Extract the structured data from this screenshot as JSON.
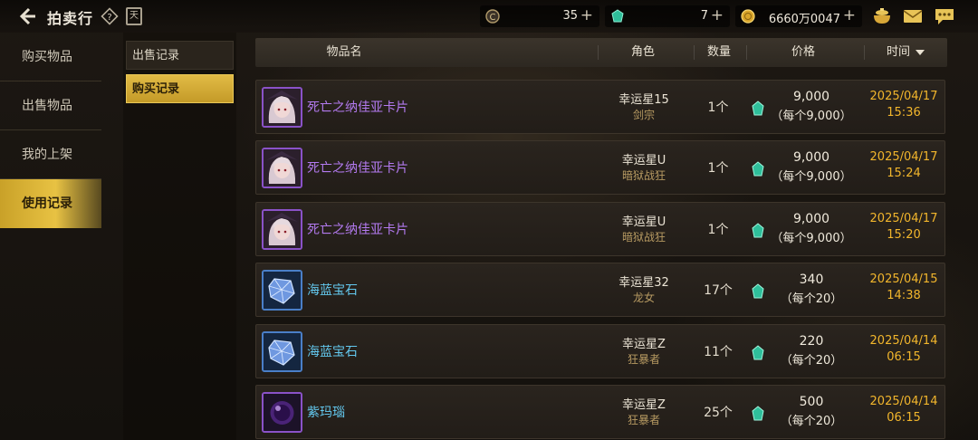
{
  "header": {
    "title": "拍卖行",
    "calendar_label": "天",
    "currencies": [
      {
        "icon": "c-coin-icon",
        "value": "35"
      },
      {
        "icon": "green-gem-icon",
        "value": "7"
      },
      {
        "icon": "gold-coin-icon",
        "value": "6660万0047"
      }
    ],
    "plus": "+"
  },
  "nav": {
    "items": [
      {
        "label": "购买物品",
        "active": false
      },
      {
        "label": "出售物品",
        "active": false
      },
      {
        "label": "我的上架",
        "active": false
      },
      {
        "label": "使用记录",
        "active": true
      }
    ]
  },
  "subnav": {
    "items": [
      {
        "label": "出售记录",
        "active": false
      },
      {
        "label": "购买记录",
        "active": true
      }
    ]
  },
  "table": {
    "columns": {
      "item": "物品名",
      "role": "角色",
      "qty": "数量",
      "price": "价格",
      "time": "时间"
    },
    "rows": [
      {
        "icon": "girl-card-icon",
        "name": "死亡之纳佳亚卡片",
        "rarity": "purple",
        "character": "幸运星15",
        "class": "剑宗",
        "qty": "1个",
        "price": "9,000",
        "each": "（每个9,000）",
        "date": "2025/04/17",
        "time": "15:36"
      },
      {
        "icon": "girl-card-icon",
        "name": "死亡之纳佳亚卡片",
        "rarity": "purple",
        "character": "幸运星U",
        "class": "暗狱战狂",
        "qty": "1个",
        "price": "9,000",
        "each": "（每个9,000）",
        "date": "2025/04/17",
        "time": "15:24"
      },
      {
        "icon": "girl-card-icon",
        "name": "死亡之纳佳亚卡片",
        "rarity": "purple",
        "character": "幸运星U",
        "class": "暗狱战狂",
        "qty": "1个",
        "price": "9,000",
        "each": "（每个9,000）",
        "date": "2025/04/17",
        "time": "15:20"
      },
      {
        "icon": "sapphire-icon",
        "name": "海蓝宝石",
        "rarity": "cyan",
        "character": "幸运星32",
        "class": "龙女",
        "qty": "17个",
        "price": "340",
        "each": "（每个20）",
        "date": "2025/04/15",
        "time": "14:38"
      },
      {
        "icon": "sapphire-icon",
        "name": "海蓝宝石",
        "rarity": "cyan",
        "character": "幸运星Z",
        "class": "狂暴者",
        "qty": "11个",
        "price": "220",
        "each": "（每个20）",
        "date": "2025/04/14",
        "time": "06:15"
      },
      {
        "icon": "amethyst-orb-icon",
        "name": "紫玛瑙",
        "rarity": "cyan",
        "character": "幸运星Z",
        "class": "狂暴者",
        "qty": "25个",
        "price": "500",
        "each": "（每个20）",
        "date": "2025/04/14",
        "time": "06:15"
      }
    ]
  },
  "colors": {
    "accent_gold": "#e2bb45",
    "date_orange": "#f2b62c",
    "rarity_purple": "#b37af0",
    "rarity_cyan": "#63c8ee"
  }
}
